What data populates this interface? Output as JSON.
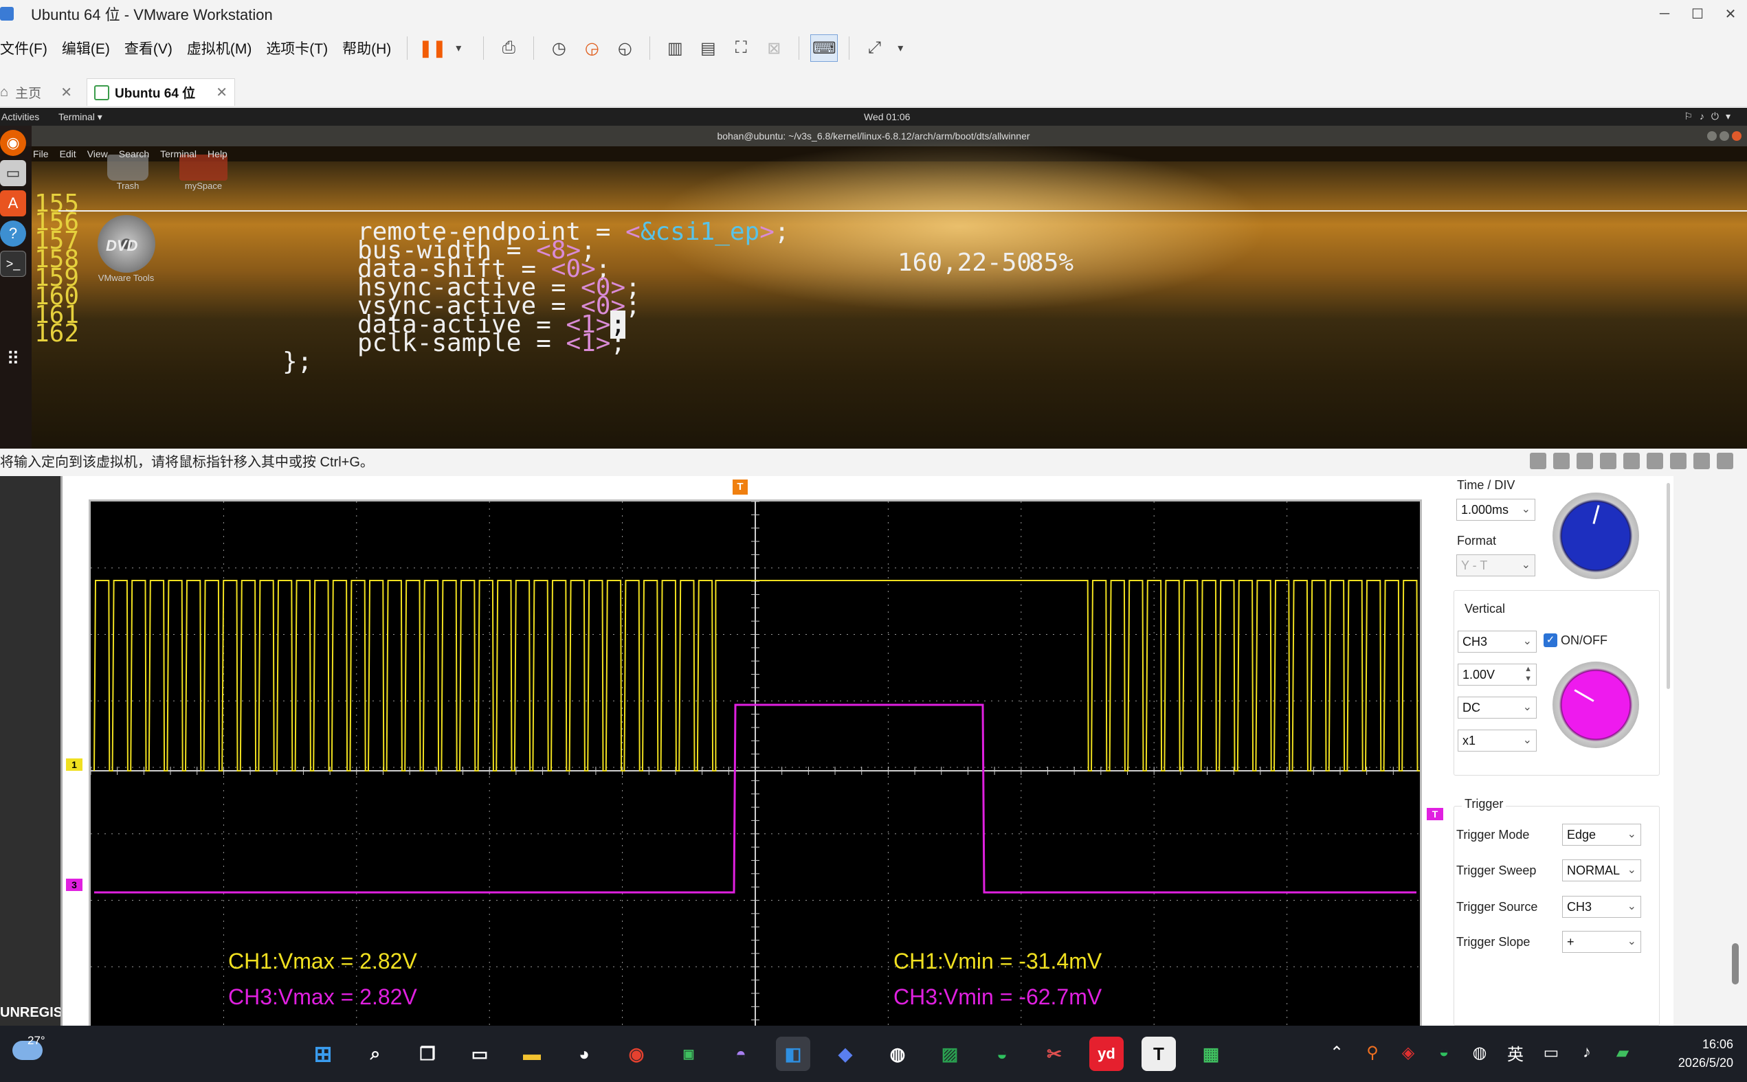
{
  "window": {
    "title": "Ubuntu 64 位 - VMware Workstation"
  },
  "menu": [
    "文件(F)",
    "编辑(E)",
    "查看(V)",
    "虚拟机(M)",
    "选项卡(T)",
    "帮助(H)"
  ],
  "tabs": [
    {
      "label": "主页"
    },
    {
      "label": "Ubuntu 64 位"
    }
  ],
  "gnome": {
    "activities": "Activities",
    "app": "Terminal ▾",
    "clock": "Wed 01:06"
  },
  "terminal": {
    "title": "bohan@ubuntu: ~/v3s_6.8/kernel/linux-6.8.12/arch/arm/boot/dts/allwinner",
    "menu": [
      "File",
      "Edit",
      "View",
      "Search",
      "Terminal",
      "Help"
    ]
  },
  "desktop": {
    "trash": "Trash",
    "myspace": "mySpace",
    "dvd": "VMware Tools",
    "dvd_logo": "DVD"
  },
  "code": {
    "lines": [
      {
        "num": "155",
        "pre": "            remote-endpoint = ",
        "val": "<&csi1_ep>",
        "post": ";"
      },
      {
        "num": "156",
        "pre": "            bus-width = ",
        "val": "<8>",
        "post": ";"
      },
      {
        "num": "157",
        "pre": "            data-shift = ",
        "val": "<0>",
        "post": ";"
      },
      {
        "num": "158",
        "pre": "            hsync-active = ",
        "val": "<0>",
        "post": ";"
      },
      {
        "num": "159",
        "pre": "            vsync-active = ",
        "val": "<0>",
        "post": ";"
      },
      {
        "num": "160",
        "pre": "            data-active = ",
        "val": "<1>",
        "post": ";"
      },
      {
        "num": "161",
        "pre": "            pclk-sample = ",
        "val": "<1>",
        "post": ";"
      },
      {
        "num": "162",
        "pre": "    ",
        "val": "",
        "post": "};"
      }
    ],
    "cursor_pos": "160,22-50",
    "percent": "85%"
  },
  "status_bar": {
    "message": "将输入定向到该虚拟机，请将鼠标指针移入其中或按 Ctrl+G。"
  },
  "scope": {
    "unregistered": "UNREGIS",
    "trigger_marker": "T",
    "ch1_marker": "1",
    "ch3_marker": "3",
    "measurements": {
      "ch1_vmax": "CH1:Vmax = 2.82V",
      "ch3_vmax": "CH3:Vmax = 2.82V",
      "ch1_vmin": "CH1:Vmin = -31.4mV",
      "ch3_vmin": "CH3:Vmin = -62.7mV"
    },
    "colors": {
      "ch1": "#f0e020",
      "ch3": "#e020e0",
      "grid": "#9a9a9a",
      "trigger": "#f08010"
    },
    "panel": {
      "time_div_label": "Time / DIV",
      "time_div_value": "1.000ms",
      "format_label": "Format",
      "format_value": "Y - T",
      "vertical_label": "Vertical",
      "channel": "CH3",
      "onoff_label": "ON/OFF",
      "volts": "1.00V",
      "coupling": "DC",
      "probe": "x1",
      "trigger_label": "Trigger",
      "trigger_mode_label": "Trigger Mode",
      "trigger_mode_value": "Edge",
      "trigger_sweep_label": "Trigger Sweep",
      "trigger_sweep_value": "NORMAL",
      "trigger_source_label": "Trigger Source",
      "trigger_source_value": "CH3",
      "trigger_slope_label": "Trigger Slope",
      "trigger_slope_value": "+"
    }
  },
  "taskbar": {
    "weather_temp": "27°",
    "time": "16:06",
    "date": "2026/5/20",
    "lang": "英",
    "apps": [
      "windows-start",
      "search",
      "task-view",
      "terminal",
      "file-explorer",
      "qq",
      "chrome",
      "fast-app",
      "cat-app",
      "vmware",
      "feishu",
      "steam",
      "sourceinsight",
      "wechat",
      "snip",
      "youdao",
      "typora",
      "monitor"
    ],
    "youdao_label": "yd",
    "typora_label": "T"
  }
}
